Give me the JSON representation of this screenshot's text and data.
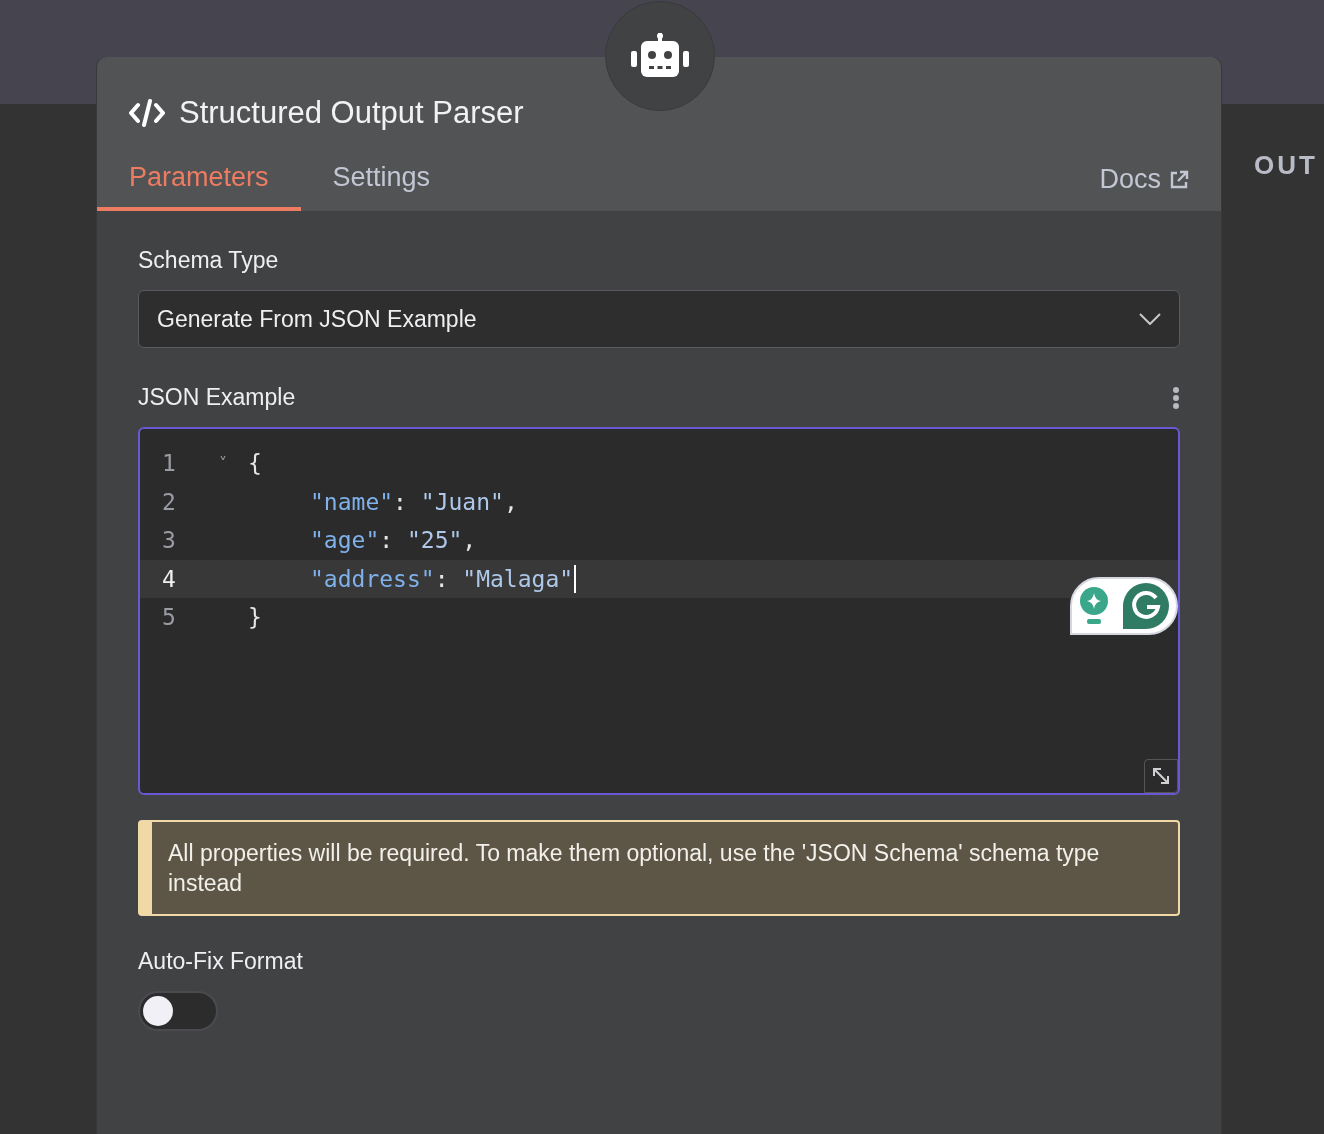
{
  "side_label": "OUT",
  "node": {
    "title": "Structured Output Parser"
  },
  "tabs": [
    {
      "label": "Parameters",
      "selected": true
    },
    {
      "label": "Settings",
      "selected": false
    }
  ],
  "docs_link": "Docs",
  "schema_type": {
    "label": "Schema Type",
    "value": "Generate From JSON Example"
  },
  "json_example": {
    "label": "JSON Example",
    "lines": [
      {
        "number": "1",
        "fold_marker": "˅",
        "indented": false,
        "active": false,
        "tokens": [
          {
            "kind": "punct",
            "text": "{"
          }
        ]
      },
      {
        "number": "2",
        "indented": true,
        "active": false,
        "tokens": [
          {
            "kind": "key",
            "text": "\"name\""
          },
          {
            "kind": "punct",
            "text": ": "
          },
          {
            "kind": "string",
            "text": "\"Juan\""
          },
          {
            "kind": "punct",
            "text": ","
          }
        ]
      },
      {
        "number": "3",
        "indented": true,
        "active": false,
        "tokens": [
          {
            "kind": "key",
            "text": "\"age\""
          },
          {
            "kind": "punct",
            "text": ": "
          },
          {
            "kind": "string",
            "text": "\"25\""
          },
          {
            "kind": "punct",
            "text": ","
          }
        ]
      },
      {
        "number": "4",
        "indented": true,
        "active": true,
        "tokens": [
          {
            "kind": "key",
            "text": "\"address\""
          },
          {
            "kind": "punct",
            "text": ": "
          },
          {
            "kind": "string",
            "text": "\"Malaga\""
          }
        ]
      },
      {
        "number": "5",
        "indented": false,
        "active": false,
        "tokens": [
          {
            "kind": "punct",
            "text": "}"
          }
        ]
      }
    ]
  },
  "notice": "All properties will be required. To make them optional, use the 'JSON Schema' schema type instead",
  "auto_fix": {
    "label": "Auto-Fix Format",
    "on": false
  }
}
